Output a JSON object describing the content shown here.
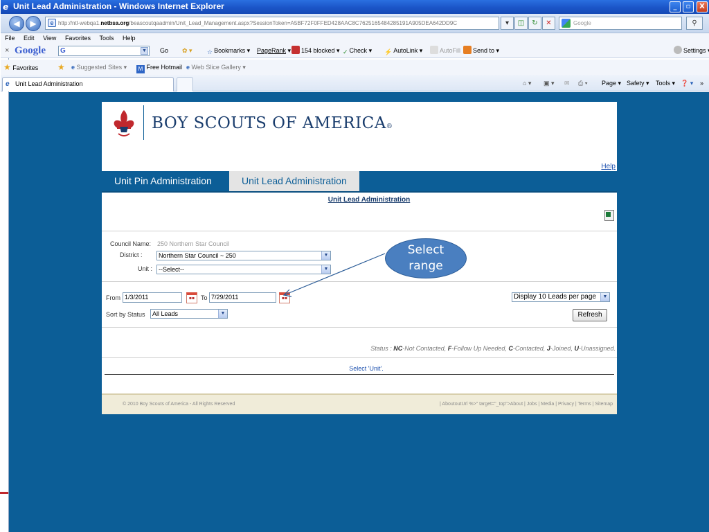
{
  "window": {
    "title": "Unit Lead Administration - Windows Internet Explorer",
    "minimize": "_",
    "maximize": "▫",
    "close": "X"
  },
  "addressbar": {
    "url_prefix": "http://ntl-webqa1.",
    "url_domain": "netbsa.org",
    "url_rest": "/beascoutqaadmin/Unit_Lead_Management.aspx?SessionToken=A5BF72F0FFED428AAC8C7625165484285191A905DEA642DD9C",
    "search_placeholder": "Google"
  },
  "menu": [
    "File",
    "Edit",
    "View",
    "Favorites",
    "Tools",
    "Help"
  ],
  "google_toolbar": {
    "logo": "Google",
    "search_value": "G",
    "items": [
      "Go",
      "Bookmarks",
      "PageRank",
      "154 blocked",
      "Check",
      "AutoLink",
      "AutoFill",
      "Send to",
      "Settings"
    ]
  },
  "favorites_bar": {
    "favorites": "Favorites",
    "suggested": "Suggested Sites",
    "hotmail": "Free Hotmail",
    "webslice": "Web Slice Gallery"
  },
  "tabs": {
    "active_label": "Unit Lead Administration",
    "commands": [
      "Page",
      "Safety",
      "Tools"
    ]
  },
  "site": {
    "org_name": "BOY SCOUTS OF AMERICA",
    "help": "Help",
    "nav": [
      "Unit Pin Administration",
      "Unit Lead Administration"
    ],
    "section_title": "Unit Lead Administration",
    "council_label": "Council Name:",
    "council_value": "250 Northern Star Council",
    "district_label": "District :",
    "district_value": "Northern Star Council ~ 250",
    "unit_label": "Unit :",
    "unit_value": "--Select--",
    "from_label": "From",
    "from_value": "1/3/2011",
    "to_label": "To",
    "to_value": "7/29/2011",
    "display_value": "Display 10 Leads per page",
    "sort_label": "Sort by Status",
    "sort_value": "All Leads",
    "refresh": "Refresh",
    "status_prefix": "Status :",
    "status_nc": "NC",
    "status_nc_text": "-Not Contacted,",
    "status_f": "F",
    "status_f_text": "-Follow Up Needed,",
    "status_c": "C",
    "status_c_text": "-Contacted,",
    "status_j": "J",
    "status_j_text": "-Joined,",
    "status_u": "U",
    "status_u_text": "-Unassigned.",
    "info_message": "Select 'Unit'.",
    "copyright": "© 2010 Boy Scouts of America - All Rights Reserved",
    "footer_links": "| AboutoutUrl %>\" target=\"_top\">About | Jobs | Media | Privacy | Terms | Sitemap"
  },
  "annotation": {
    "line1": "Select",
    "line2": "range"
  },
  "colors": {
    "page_blue": "#0c5e97",
    "callout_blue": "#4a7fc0",
    "link_blue": "#1b4fae"
  }
}
